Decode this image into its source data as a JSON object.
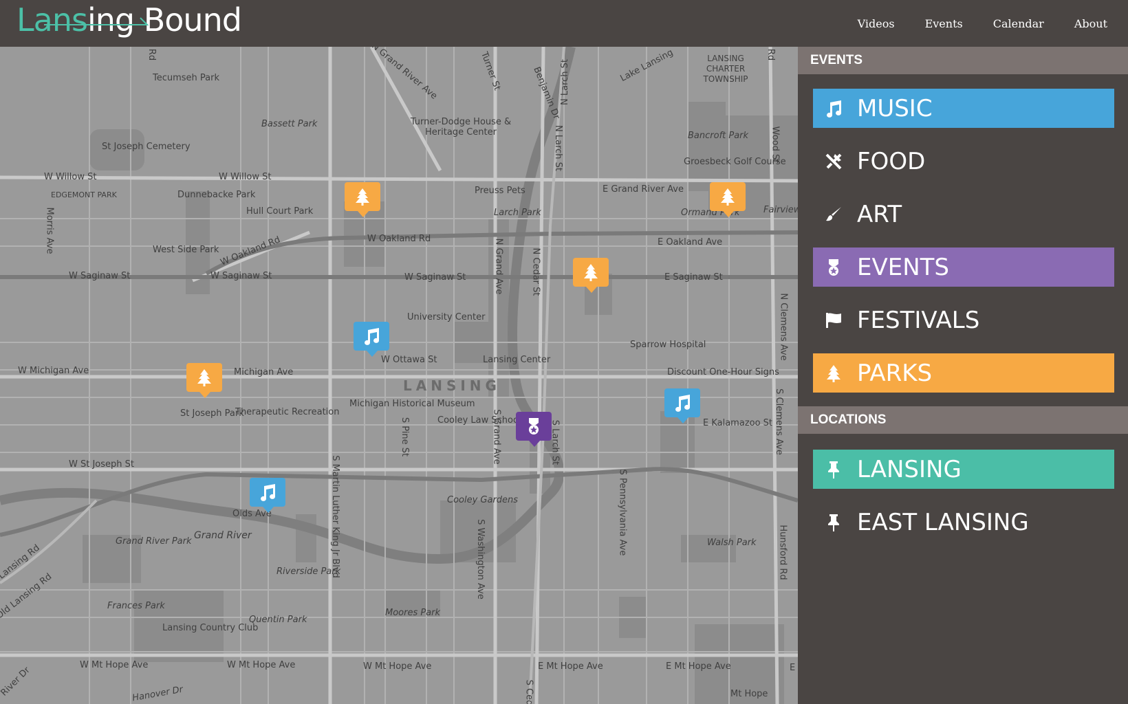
{
  "brand": {
    "name_part1": "Lan",
    "name_part2": "s",
    "name_part3": "ing",
    "name_part4": "Bound"
  },
  "nav": {
    "items": [
      "Videos",
      "Events",
      "Calendar",
      "About"
    ]
  },
  "map": {
    "city_label": "LANSING",
    "labels": [
      "Tecumseh Park",
      "St Joseph Cemetery",
      "Bassett Park",
      "Turner-Dodge House & Heritage Center",
      "LANSING CHARTER TOWNSHIP",
      "Bancroft Park",
      "Groesbeck Golf Course",
      "W Willow St",
      "W Willow St",
      "EDGEMONT PARK",
      "Dunnebacke Park",
      "Hull Court Park",
      "Preuss Pets",
      "Larch Park",
      "E Grand River Ave",
      "Ormand Park",
      "Fairview Park",
      "W Oakland Rd",
      "W Oakland Rd",
      "E Oakland Ave",
      "West Side Park",
      "W Saginaw St",
      "W Saginaw St",
      "W Saginaw St",
      "E Saginaw St",
      "University Center",
      "W Ottawa St",
      "Lansing Center",
      "Sparrow Hospital",
      "Discount One-Hour Signs",
      "W Michigan Ave",
      "Michigan Ave",
      "St Joseph Park",
      "Therapeutic Recreation",
      "Michigan Historical Museum",
      "Cooley Law School",
      "E Kalamazoo St",
      "W St Joseph St",
      "Olds Ave",
      "Cooley Gardens",
      "Grand River",
      "Grand River Park",
      "Walsh Park",
      "Riverside Park",
      "Frances Park",
      "Lansing Country Club",
      "Quentin Park",
      "Moores Park",
      "W Mt Hope Ave",
      "W Mt Hope Ave",
      "W Mt Hope Ave",
      "E Mt Hope Ave",
      "E Mt Hope Ave",
      "Mt Hope",
      "Hanover Dr",
      "Old Lansing Rd",
      "Lansing Rd",
      "Morris Ave",
      "N Grand River Ave",
      "Turner St",
      "Benjamin Dr",
      "N Larch St",
      "Lake Lansing",
      "Wood St",
      "N Grand Ave",
      "N Cedar St",
      "N Larch St",
      "N Clemens Ave",
      "S Pine St",
      "S Grand Ave",
      "S Larch St",
      "S Martin Luther King Jr Blvd",
      "S Washington Ave",
      "S Pennsylvania Ave",
      "S Clemens Ave",
      "Hunsford Rd",
      "River Dr",
      "Rd",
      "Rd",
      "S Ced",
      "E"
    ]
  },
  "panel": {
    "events_header": "EVENTS",
    "locations_header": "LOCATIONS",
    "categories": [
      "MUSIC",
      "FOOD",
      "ART",
      "EVENTS",
      "FESTIVALS",
      "PARKS"
    ],
    "locations": [
      "LANSING",
      "EAST LANSING"
    ]
  },
  "colors": {
    "music": "#47a5da",
    "events": "#8a6bb3",
    "parks": "#f7a944",
    "lansing": "#4bbea7",
    "panel_bg": "#4a4543",
    "section_header": "#7c7371",
    "event_marker": "#6a3f9a"
  },
  "icons": {
    "music": "music-note-icon",
    "food": "fork-knife-icon",
    "art": "paintbrush-icon",
    "events": "medal-icon",
    "festivals": "flag-icon",
    "parks": "tree-icon",
    "locations": "pushpin-icon"
  }
}
